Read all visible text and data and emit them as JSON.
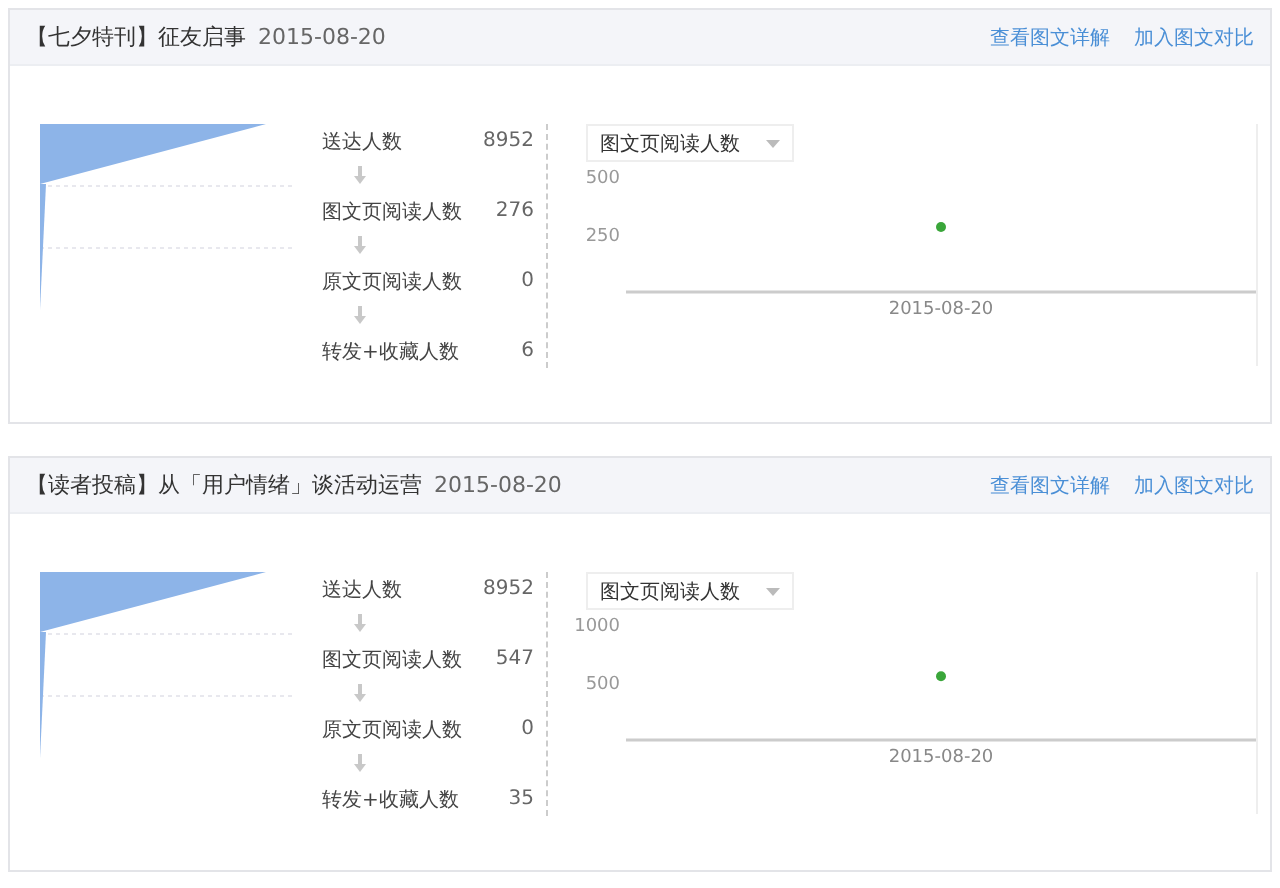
{
  "articles": [
    {
      "title": "【七夕特刊】征友启事",
      "date": "2015-08-20",
      "links": [
        "查看图文详解",
        "加入图文对比"
      ],
      "stats": [
        {
          "label": "送达人数",
          "value": "8952"
        },
        {
          "label": "图文页阅读人数",
          "value": "276"
        },
        {
          "label": "原文页阅读人数",
          "value": "0"
        },
        {
          "label": "转发+收藏人数",
          "value": "6"
        }
      ],
      "metric_select": {
        "value": "图文页阅读人数"
      },
      "chart_data": {
        "type": "scatter",
        "categories": [
          "2015-08-20"
        ],
        "series": [
          {
            "color": "#3aa63a",
            "values": [
              280
            ]
          }
        ],
        "ylim": [
          0,
          500
        ],
        "yticks": [
          250,
          500
        ]
      }
    },
    {
      "title": "【读者投稿】从「用户情绪」谈活动运营",
      "date": "2015-08-20",
      "links": [
        "查看图文详解",
        "加入图文对比"
      ],
      "stats": [
        {
          "label": "送达人数",
          "value": "8952"
        },
        {
          "label": "图文页阅读人数",
          "value": "547"
        },
        {
          "label": "原文页阅读人数",
          "value": "0"
        },
        {
          "label": "转发+收藏人数",
          "value": "35"
        }
      ],
      "metric_select": {
        "value": "图文页阅读人数"
      },
      "chart_data": {
        "type": "scatter",
        "categories": [
          "2015-08-20"
        ],
        "series": [
          {
            "color": "#3aa63a",
            "values": [
              550
            ]
          }
        ],
        "ylim": [
          0,
          1000
        ],
        "yticks": [
          500,
          1000
        ]
      }
    }
  ]
}
